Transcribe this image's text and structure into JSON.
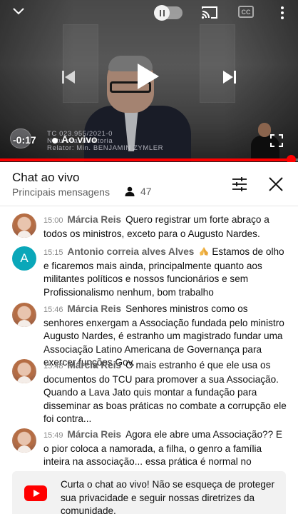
{
  "player": {
    "elapsed": "-0:17",
    "live_label": "Ao vivo",
    "cc_label": "CC",
    "caption_lines": [
      "TC 023.955/2021-0",
      "Natureza: Auditoria",
      "Relator: Min. BENJAMIN ZYMLER"
    ],
    "progress_fraction": 0.97,
    "icons": {
      "collapse": "chevron-down-icon",
      "autoplay": "autoplay-toggle",
      "cast": "cast-icon",
      "captions": "cc-icon",
      "more": "more-vert-icon",
      "previous": "skip-previous-icon",
      "play": "play-icon",
      "next": "skip-next-icon",
      "fullscreen": "fullscreen-icon"
    },
    "accent_color": "#ff0000"
  },
  "chat": {
    "title": "Chat ao vivo",
    "subtitle": "Principais mensagens",
    "viewer_count": "47",
    "icons": {
      "viewers": "person-icon",
      "filter": "tune-icon",
      "close": "close-icon"
    }
  },
  "messages": [
    {
      "time": "15:00",
      "author": "Márcia Reis",
      "text": "Quero registrar um forte abraço a todos os ministros, exceto para o Augusto Nardes.",
      "avatar": "photo"
    },
    {
      "time": "15:15",
      "author": "Antonio correia alves Alves",
      "emoji": "folded-hands-emoji",
      "text": "Estamos de olho e ficaremos mais ainda, principalmente quanto aos militantes políticos e nossos funcionários e sem Profissionalismo nenhum, bom trabalho",
      "avatar": "letter",
      "avatar_letter": "A",
      "avatar_color": "#0aa7b9"
    },
    {
      "time": "15:46",
      "author": "Márcia Reis",
      "text": "Senhores ministros como os senhores enxergam a Associação fundada pelo ministro Augusto Nardes, é estranho um magistrado fundar uma Associação Latino Americana de Governança para exercer funções Gov.",
      "avatar": "photo"
    },
    {
      "time": "15:48",
      "author": "Márcia Reis",
      "text": "O mais estranho é que ele usa os documentos do TCU para promover a sua Associação. Quando a Lava Jato quis montar a fundação para disseminar as boas práticas no combate a corrupção ele foi contra...",
      "avatar": "photo"
    },
    {
      "time": "15:49",
      "author": "Márcia Reis",
      "text": "Agora ele abre uma Associação?? E o pior coloca a namorada, a filha, o genro a família inteira na associação... essa prática é normal no TCU???",
      "avatar": "photo"
    }
  ],
  "notice": {
    "text": "Curta o chat ao vivo! Não se esqueça de proteger sua privacidade e seguir nossas diretrizes da comunidade.",
    "icon": "youtube-logo-icon",
    "icon_color": "#ff0000"
  }
}
